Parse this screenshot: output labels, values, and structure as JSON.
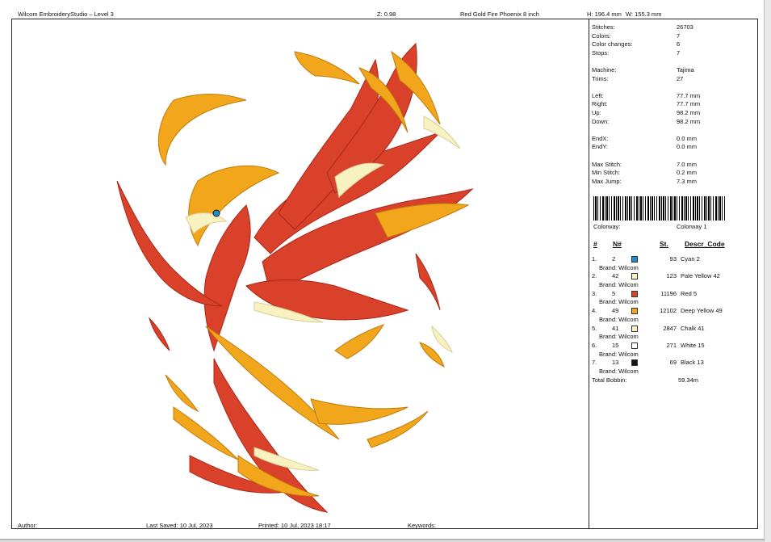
{
  "header": {
    "app_title": "Wilcom EmbroideryStudio – Level 3",
    "zoom": "Z: 0.98",
    "design_name": "Red Gold Fire Phoenix 8 inch",
    "height": "H: 196.4 mm",
    "width": "W: 155.3 mm"
  },
  "stats": [
    {
      "label": "Stitches:",
      "value": "26703"
    },
    {
      "label": "Colors:",
      "value": "7"
    },
    {
      "label": "Color changes:",
      "value": "6"
    },
    {
      "label": "Stops:",
      "value": "7"
    },
    {
      "gap": true
    },
    {
      "label": "Machine:",
      "value": "Tajima"
    },
    {
      "label": "Trims:",
      "value": "27"
    },
    {
      "gap": true
    },
    {
      "label": "Left:",
      "value": "77.7 mm"
    },
    {
      "label": "Right:",
      "value": "77.7 mm"
    },
    {
      "label": "Up:",
      "value": "98.2 mm"
    },
    {
      "label": "Down:",
      "value": "98.2 mm"
    },
    {
      "gap": true
    },
    {
      "label": "EndX:",
      "value": "0.0 mm"
    },
    {
      "label": "EndY:",
      "value": "0.0 mm"
    },
    {
      "gap": true
    },
    {
      "label": "Max Stitch:",
      "value": "7.0 mm"
    },
    {
      "label": "Min Stitch:",
      "value": "0.2 mm"
    },
    {
      "label": "Max Jump:",
      "value": "7.3 mm"
    }
  ],
  "colorway": {
    "label": "Colorway:",
    "value": "Colorway 1"
  },
  "table_headers": {
    "num": "#",
    "needle": "N#",
    "stitches": "St.",
    "descr": "Descr_Code"
  },
  "colors": [
    {
      "idx": "1.",
      "needle": "2",
      "stitches": "93",
      "name": "Cyan 2",
      "hex": "#1a8fcf",
      "brand": "Brand: Wilcom"
    },
    {
      "idx": "2.",
      "needle": "42",
      "stitches": "123",
      "name": "Pale Yellow 42",
      "hex": "#fbf3c4",
      "brand": "Brand: Wilcom"
    },
    {
      "idx": "3.",
      "needle": "5",
      "stitches": "11196",
      "name": "Red 5",
      "hex": "#d9412b",
      "brand": "Brand: Wilcom"
    },
    {
      "idx": "4.",
      "needle": "49",
      "stitches": "12102",
      "name": "Deep Yellow 49",
      "hex": "#f2a61c",
      "brand": "Brand: Wilcom"
    },
    {
      "idx": "5.",
      "needle": "41",
      "stitches": "2847",
      "name": "Chalk 41",
      "hex": "#f8f2c0",
      "brand": "Brand: Wilcom"
    },
    {
      "idx": "6.",
      "needle": "15",
      "stitches": "271",
      "name": "White 15",
      "hex": "#ffffff",
      "brand": "Brand: Wilcom"
    },
    {
      "idx": "7.",
      "needle": "13",
      "stitches": "69",
      "name": "Black 13",
      "hex": "#111111",
      "brand": "Brand: Wilcom"
    }
  ],
  "total_bobbin": {
    "label": "Total Bobbin:",
    "value": "59.34m"
  },
  "footer": {
    "author": "Author:",
    "last_saved": "Last Saved: 10 Jul, 2023",
    "printed": "Printed: 10 Jul, 2023 18:17",
    "keywords": "Keywords:"
  }
}
